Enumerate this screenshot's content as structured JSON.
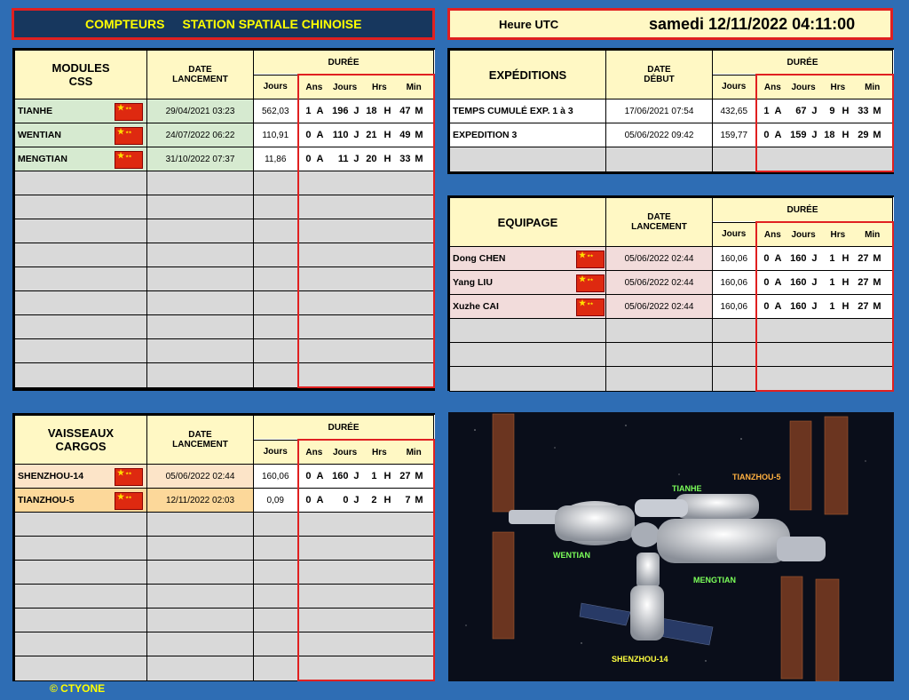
{
  "title": {
    "part1": "COMPTEURS",
    "part2": "STATION SPATIALE CHINOISE"
  },
  "utc": {
    "label": "Heure UTC",
    "value": "samedi 12/11/2022 04:11:00"
  },
  "duration_headers": {
    "duree": "DURÉE",
    "jours": "Jours",
    "ans": "Ans",
    "jours2": "Jours",
    "hrs": "Hrs",
    "min": "Min"
  },
  "modules": {
    "header_line1": "MODULES",
    "header_line2": "CSS",
    "date_line1": "DATE",
    "date_line2": "LANCEMENT",
    "rows": [
      {
        "name": "TIANHE",
        "date": "29/04/2021 03:23",
        "jours": "562,03",
        "a": "1",
        "j": "196",
        "h": "18",
        "m": "47"
      },
      {
        "name": "WENTIAN",
        "date": "24/07/2022 06:22",
        "jours": "110,91",
        "a": "0",
        "j": "110",
        "h": "21",
        "m": "49"
      },
      {
        "name": "MENGTIAN",
        "date": "31/10/2022 07:37",
        "jours": "11,86",
        "a": "0",
        "j": "11",
        "h": "20",
        "m": "33"
      }
    ]
  },
  "expeditions": {
    "header": "EXPÉDITIONS",
    "date_line1": "DATE",
    "date_line2": "DÉBUT",
    "rows": [
      {
        "name": "TEMPS CUMULÉ EXP. 1 à 3",
        "date": "17/06/2021 07:54",
        "jours": "432,65",
        "a": "1",
        "j": "67",
        "h": "9",
        "m": "33"
      },
      {
        "name": "EXPEDITION 3",
        "date": "05/06/2022 09:42",
        "jours": "159,77",
        "a": "0",
        "j": "159",
        "h": "18",
        "m": "29"
      }
    ]
  },
  "equipage": {
    "header": "EQUIPAGE",
    "date_line1": "DATE",
    "date_line2": "LANCEMENT",
    "rows": [
      {
        "name": "Dong CHEN",
        "date": "05/06/2022 02:44",
        "jours": "160,06",
        "a": "0",
        "j": "160",
        "h": "1",
        "m": "27"
      },
      {
        "name": "Yang LIU",
        "date": "05/06/2022 02:44",
        "jours": "160,06",
        "a": "0",
        "j": "160",
        "h": "1",
        "m": "27"
      },
      {
        "name": "Xuzhe CAI",
        "date": "05/06/2022 02:44",
        "jours": "160,06",
        "a": "0",
        "j": "160",
        "h": "1",
        "m": "27"
      }
    ]
  },
  "vaisseaux": {
    "header_line1": "VAISSEAUX",
    "header_line2": "CARGOS",
    "date_line1": "DATE",
    "date_line2": "LANCEMENT",
    "rows": [
      {
        "name": "SHENZHOU-14",
        "date": "05/06/2022 02:44",
        "jours": "160,06",
        "a": "0",
        "j": "160",
        "h": "1",
        "m": "27"
      },
      {
        "name": "TIANZHOU-5",
        "date": "12/11/2022 02:03",
        "jours": "0,09",
        "a": "0",
        "j": "0",
        "h": "2",
        "m": "7"
      }
    ]
  },
  "units": {
    "a": "A",
    "j": "J",
    "h": "H",
    "m": "M"
  },
  "photo_labels": {
    "tianhe": "TIANHE",
    "tianzhou": "TIANZHOU-5",
    "wentian": "WENTIAN",
    "mengtian": "MENGTIAN",
    "shenzhou": "SHENZHOU-14"
  },
  "footer": "©   CTYONE",
  "colors": {
    "background": "#2e6db4",
    "title_bg": "#17375e",
    "title_text": "#ffff00",
    "accent_red": "#e02020",
    "header_yellow": "#fff8c4",
    "module_green": "#d6ead0",
    "crew_pink": "#f2dcdb",
    "shenzhou_peach": "#fce4c8",
    "tianzhou_orange": "#fcd89a",
    "flag_red": "#de2910"
  },
  "icons": {
    "flag": "china-flag-icon"
  }
}
